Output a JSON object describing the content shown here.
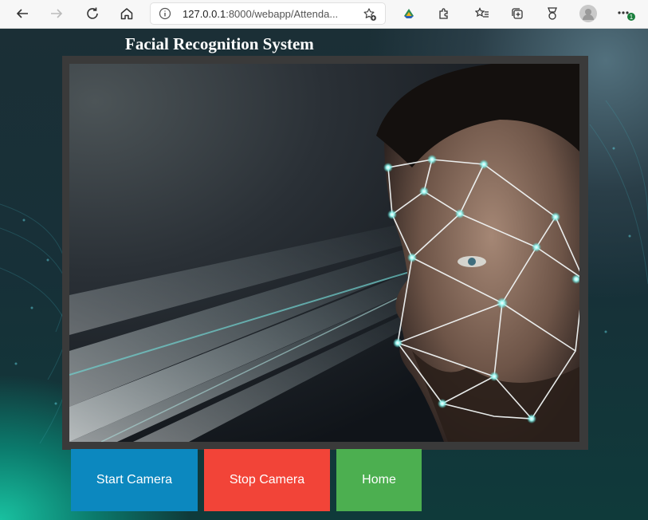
{
  "browser": {
    "url_host": "127.0.0.1",
    "url_rest": ":8000/webapp/Attenda...",
    "notification_badge": "1"
  },
  "page": {
    "title": "Facial Recognition System"
  },
  "buttons": {
    "start": "Start Camera",
    "stop": "Stop Camera",
    "home": "Home"
  },
  "colors": {
    "start_button": "#0c88bf",
    "stop_button": "#f24438",
    "home_button": "#4caf50"
  }
}
